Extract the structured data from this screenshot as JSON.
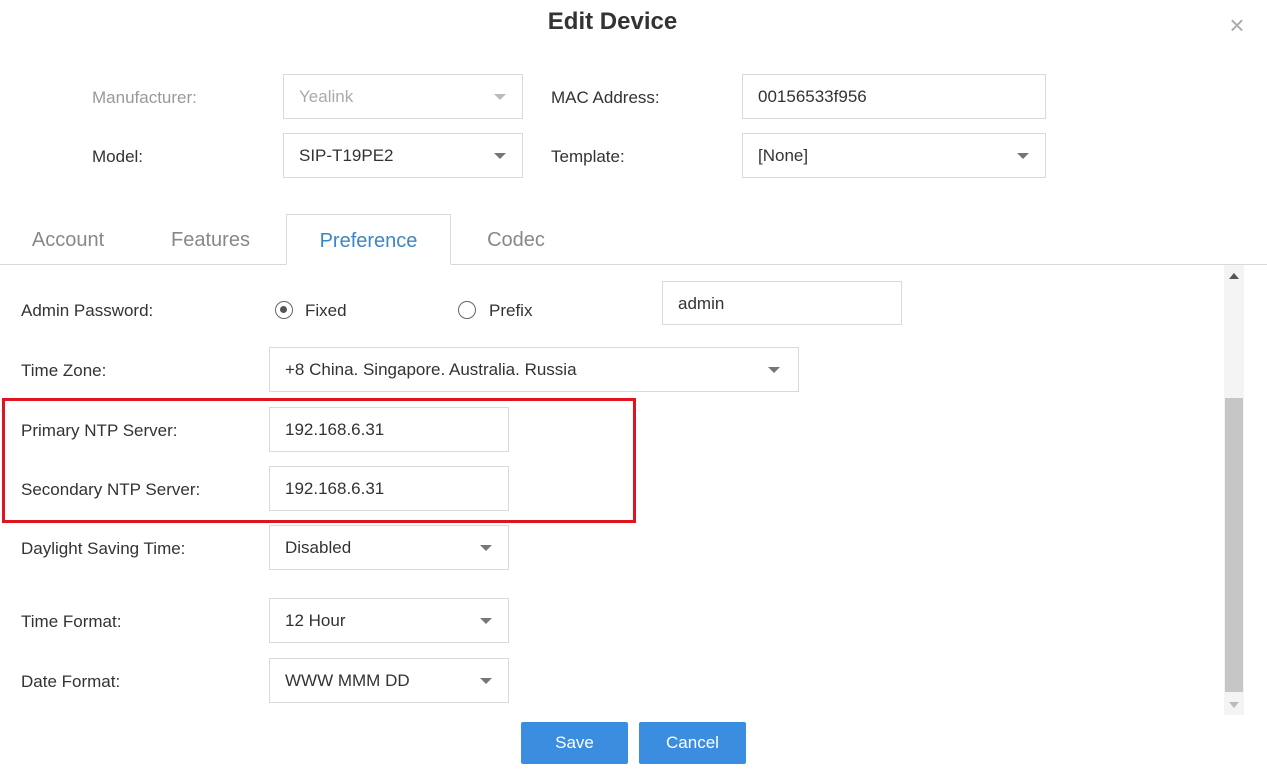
{
  "dialog": {
    "title": "Edit Device",
    "close_glyph": "×"
  },
  "device": {
    "manufacturer_label": "Manufacturer:",
    "manufacturer_value": "Yealink",
    "mac_label": "MAC Address:",
    "mac_value": "00156533f956",
    "model_label": "Model:",
    "model_value": "SIP-T19PE2",
    "template_label": "Template:",
    "template_value": "[None]"
  },
  "tabs": [
    {
      "label": "Account",
      "active": false
    },
    {
      "label": "Features",
      "active": false
    },
    {
      "label": "Preference",
      "active": true
    },
    {
      "label": "Codec",
      "active": false
    }
  ],
  "preference": {
    "admin_password_label": "Admin Password:",
    "radio_fixed_label": "Fixed",
    "radio_prefix_label": "Prefix",
    "admin_password_mode": "Fixed",
    "admin_password_value": "admin",
    "time_zone_label": "Time Zone:",
    "time_zone_value": "+8 China. Singapore. Australia. Russia",
    "primary_ntp_label": "Primary NTP Server:",
    "primary_ntp_value": "192.168.6.31",
    "secondary_ntp_label": "Secondary NTP Server:",
    "secondary_ntp_value": "192.168.6.31",
    "dst_label": "Daylight Saving Time:",
    "dst_value": "Disabled",
    "time_format_label": "Time Format:",
    "time_format_value": "12 Hour",
    "date_format_label": "Date Format:",
    "date_format_value": "WWW MMM DD"
  },
  "buttons": {
    "save": "Save",
    "cancel": "Cancel"
  },
  "colors": {
    "accent": "#3b86c8",
    "button": "#3b8de0",
    "highlight": "#e0141e"
  }
}
